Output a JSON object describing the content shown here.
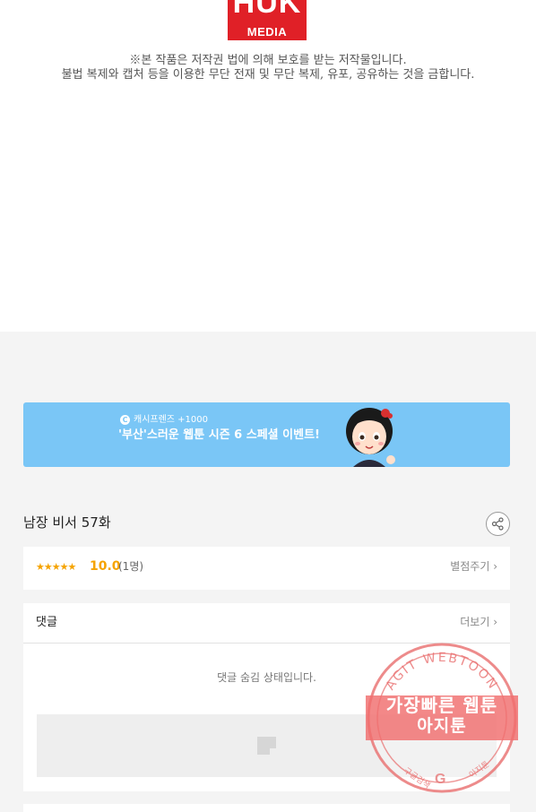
{
  "header": {
    "logo_top": "HUK",
    "logo_bottom": "MEDIA",
    "copyright_line1": "※본 작품은 저작권 법에 의해 보호를 받는 저작물입니다.",
    "copyright_line2": "불법 복제와 캡처 등을 이용한 무단 전재 및 무단 복제, 유포, 공유하는 것을 금합니다."
  },
  "banner": {
    "tag": "캐시프렌즈 +1000",
    "text": "'부산'스러운 웹툰 시즌 6 스페셜 이벤트!"
  },
  "episode": {
    "title": "남장 비서 57화"
  },
  "rating": {
    "stars": "★★★★★",
    "score": "10.0",
    "count": "(1명)",
    "rate_link": "별점주기 ›"
  },
  "comments": {
    "title": "댓글",
    "more": "더보기 ›",
    "hidden_message": "댓글 숨김 상태입니다."
  },
  "watermark": {
    "ring_top": "AGIT WEBTOON",
    "line1": "가장빠른 웹툰",
    "line2": "아지툰",
    "ring_left": "구글검색",
    "ring_right": "아지툰",
    "g_logo": "G"
  },
  "colors": {
    "brand_red": "#e02027",
    "banner_blue": "#7ac6f6",
    "star_orange": "#f5a300",
    "stamp_pink": "#f06e6e"
  }
}
